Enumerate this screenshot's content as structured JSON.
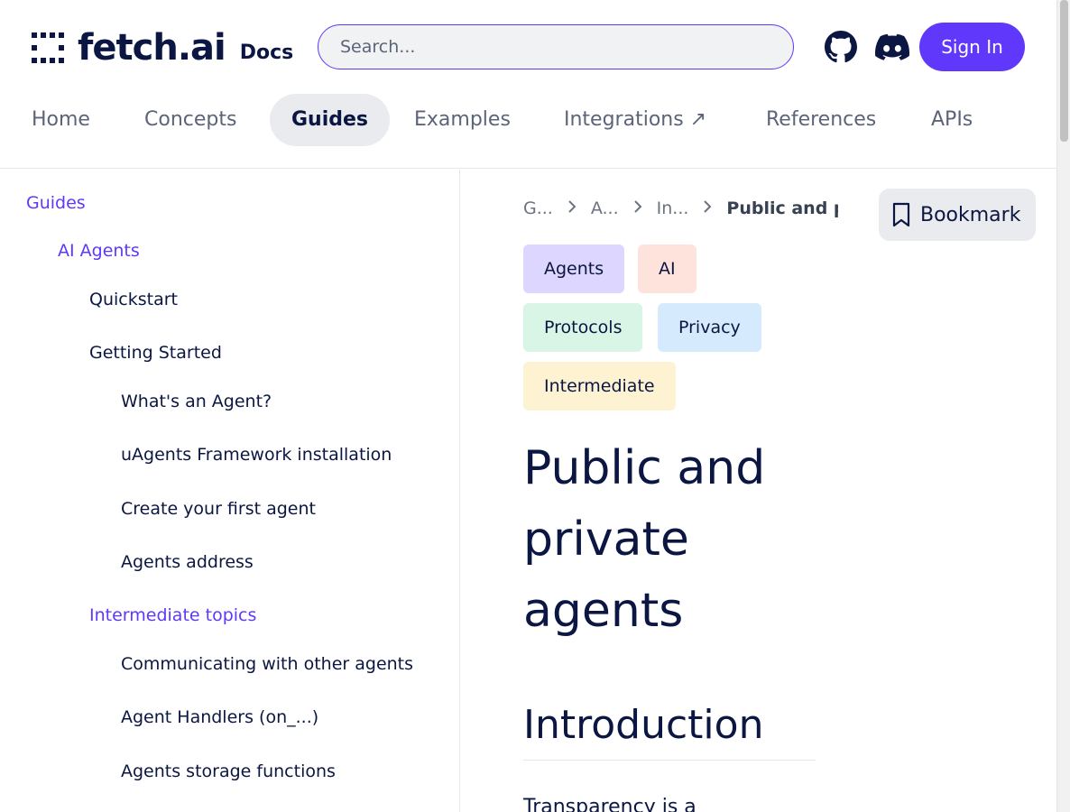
{
  "header": {
    "logo_text": "fetch.ai",
    "logo_sub": "Docs",
    "search_placeholder": "Search...",
    "github_icon": "github-icon",
    "discord_icon": "discord-icon",
    "signin_label": "Sign In",
    "accent_color": "#5f38fb"
  },
  "nav": {
    "tabs": [
      {
        "label": "Home",
        "active": false
      },
      {
        "label": "Concepts",
        "active": false
      },
      {
        "label": "Guides",
        "active": true
      },
      {
        "label": "Examples",
        "active": false
      },
      {
        "label": "Integrations ↗",
        "active": false
      },
      {
        "label": "References",
        "active": false
      },
      {
        "label": "APIs",
        "active": false
      }
    ]
  },
  "sidebar": {
    "items": [
      {
        "label": "Guides",
        "accent": true
      },
      {
        "label": "AI Agents",
        "accent": true
      },
      {
        "label": "Quickstart",
        "accent": false
      },
      {
        "label": "Getting Started",
        "accent": false
      },
      {
        "label": "What's an Agent?",
        "accent": false
      },
      {
        "label": "uAgents Framework installation",
        "accent": false
      },
      {
        "label": "Create your first agent",
        "accent": false
      },
      {
        "label": "Agents address",
        "accent": false
      },
      {
        "label": "Intermediate topics",
        "accent": true
      },
      {
        "label": "Communicating with other agents",
        "accent": false
      },
      {
        "label": "Agent Handlers (on_...)",
        "accent": false
      },
      {
        "label": "Agents storage functions",
        "accent": false
      }
    ]
  },
  "main": {
    "breadcrumbs": [
      "G...",
      "A...",
      "In...",
      "Public and p"
    ],
    "bookmark_label": "Bookmark",
    "bookmark_icon": "bookmark-icon",
    "chevron_icon": "chevron-right-icon",
    "tags": [
      {
        "label": "Agents",
        "color": "#ddd6fe"
      },
      {
        "label": "AI",
        "color": "#fee2dc"
      },
      {
        "label": "Protocols",
        "color": "#d9f5e5"
      },
      {
        "label": "Privacy",
        "color": "#d6eafd"
      },
      {
        "label": "Intermediate",
        "color": "#fdf2d2"
      }
    ],
    "title": "Public and private agents",
    "section_heading": "Introduction",
    "intro_text": "Transparency is a"
  }
}
